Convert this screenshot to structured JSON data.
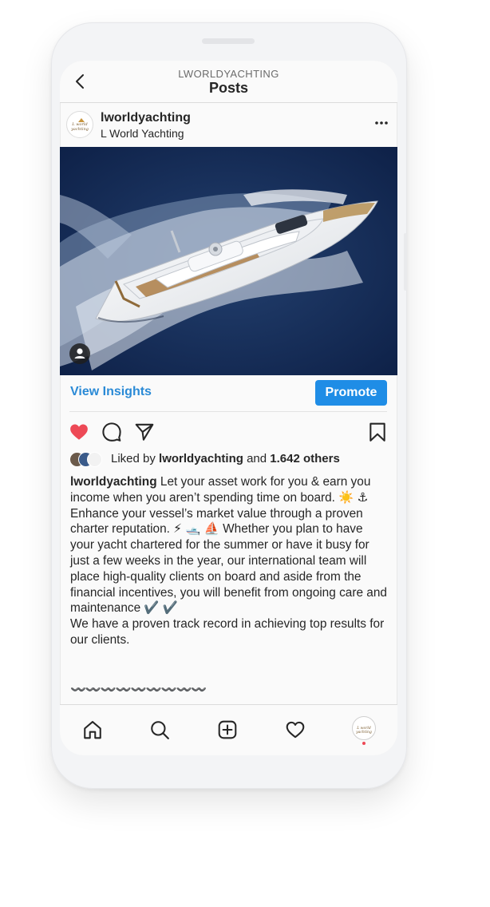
{
  "header": {
    "account": "LWORLDYACHTING",
    "title": "Posts"
  },
  "post": {
    "username": "lworldyachting",
    "full_name": "L World Yachting",
    "avatar_text": "L world yachting",
    "insights_label": "View Insights",
    "promote_label": "Promote",
    "liked_by_prefix": "Liked by",
    "liked_by_user": "lworldyachting",
    "liked_by_and": "and",
    "liked_by_count": "1.642 others",
    "caption_username": "lworldyachting",
    "caption_p1": "Let your asset work for you & earn you income when you aren’t spending time on board. ☀️ ⚓",
    "caption_p2": "Enhance your vessel’s market value through a proven charter reputation. ⚡ 🛥️ ⛵ Whether you plan to have your yacht chartered for the summer or have it busy for just a few weeks in the year, our international team will place high-quality clients on board and aside from the financial incentives, you will benefit from ongoing care and maintenance ✔️ ✔️",
    "caption_p3": "We have a proven track record in achieving top results for our clients.",
    "caption_wave": "〰️〰️〰️〰️〰️〰️〰️〰️〰️"
  },
  "colors": {
    "accent": "#1f8de6",
    "link": "#2a8ad6",
    "like": "#ed4956"
  },
  "icons": [
    "back-arrow-icon",
    "more-options-icon",
    "heart-icon",
    "comment-icon",
    "share-icon",
    "bookmark-icon",
    "home-icon",
    "search-icon",
    "new-post-icon",
    "activity-heart-icon",
    "profile-icon",
    "user-tag-icon"
  ]
}
